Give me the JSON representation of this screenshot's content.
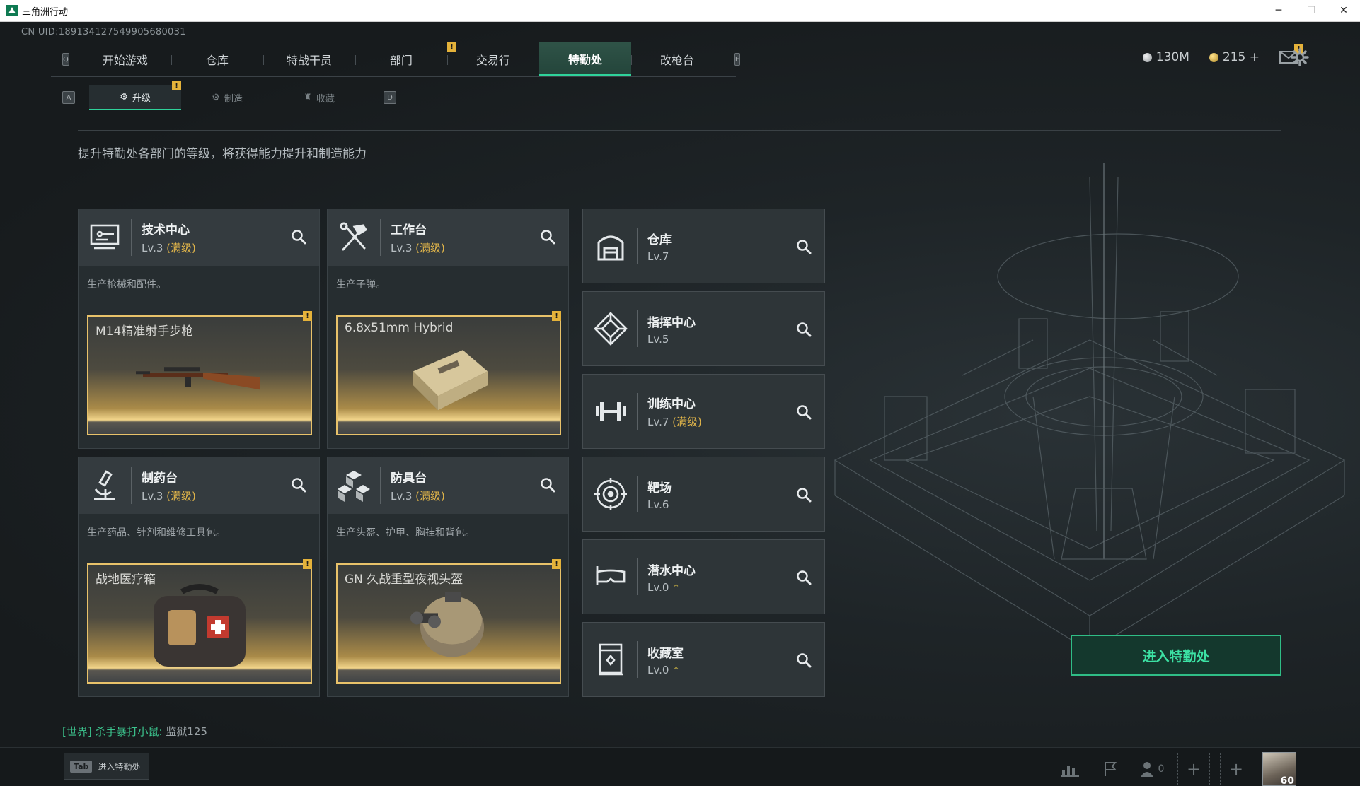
{
  "window": {
    "title": "三角洲行动",
    "controls": {
      "minimize": "─",
      "maximize": "☐",
      "close": "✕"
    }
  },
  "uid": "CN UID:18913412754990568003​1",
  "topnav": {
    "left_key": "Q",
    "right_key": "E",
    "tabs": [
      "开始游戏",
      "仓库",
      "特战干员",
      "部门",
      "交易行",
      "特勤处",
      "改枪台"
    ],
    "active_tab": "特勤处",
    "badge": "!"
  },
  "status": {
    "silver": "130M",
    "gold": "215 +",
    "badge": "!"
  },
  "subnav": {
    "left_key": "A",
    "right_key": "D",
    "tabs": [
      "升级",
      "制造",
      "收藏"
    ],
    "active": "升级",
    "badge": "!"
  },
  "description": "提升特勤处各部门的等级，将获得能力提升和制造能力",
  "cards": [
    {
      "name": "技术中心",
      "level": "Lv.3",
      "maxed": "(满级)",
      "desc": "生产枪械和配件。",
      "product": "M14精准射手步枪",
      "icon": "computer-icon",
      "badge": "!"
    },
    {
      "name": "工作台",
      "level": "Lv.3",
      "maxed": "(满级)",
      "desc": "生产子弹。",
      "product": "6.8x51mm Hybrid",
      "icon": "tools-icon",
      "badge": "!"
    },
    {
      "name": "制药台",
      "level": "Lv.3",
      "maxed": "(满级)",
      "desc": "生产药品、针剂和维修工具包。",
      "product": "战地医疗箱",
      "icon": "microscope-icon",
      "badge": "!"
    },
    {
      "name": "防具台",
      "level": "Lv.3",
      "maxed": "(满级)",
      "desc": "生产头盔、护甲、胸挂和背包。",
      "product": "GN 久战重型夜视头盔",
      "icon": "blocks-icon",
      "badge": "!"
    }
  ],
  "facilities": [
    {
      "name": "仓库",
      "level": "Lv.7",
      "maxed": "",
      "icon": "warehouse-icon"
    },
    {
      "name": "指挥中心",
      "level": "Lv.5",
      "maxed": "",
      "icon": "command-icon"
    },
    {
      "name": "训练中心",
      "level": "Lv.7",
      "maxed": "(满级)",
      "icon": "dumbbell-icon"
    },
    {
      "name": "靶场",
      "level": "Lv.6",
      "maxed": "",
      "icon": "target-icon"
    },
    {
      "name": "潜水中心",
      "level": "Lv.0",
      "maxed": "",
      "icon": "goggles-icon",
      "upgrade_arrow": "⌃"
    },
    {
      "name": "收藏室",
      "level": "Lv.0",
      "maxed": "",
      "icon": "showcase-icon",
      "upgrade_arrow": "⌃"
    }
  ],
  "enter_button": "进入特勤处",
  "chat": {
    "channel": "[世界]",
    "user": "杀手暴打小鼠:",
    "message": "监狱125"
  },
  "bottom": {
    "tab_key": "Tab",
    "tab_label": "进入特勤处",
    "friends_count": "0",
    "player_level": "60"
  },
  "colors": {
    "accent": "#2fd39b",
    "gold": "#e2b64a",
    "badge": "#e4b23a"
  }
}
